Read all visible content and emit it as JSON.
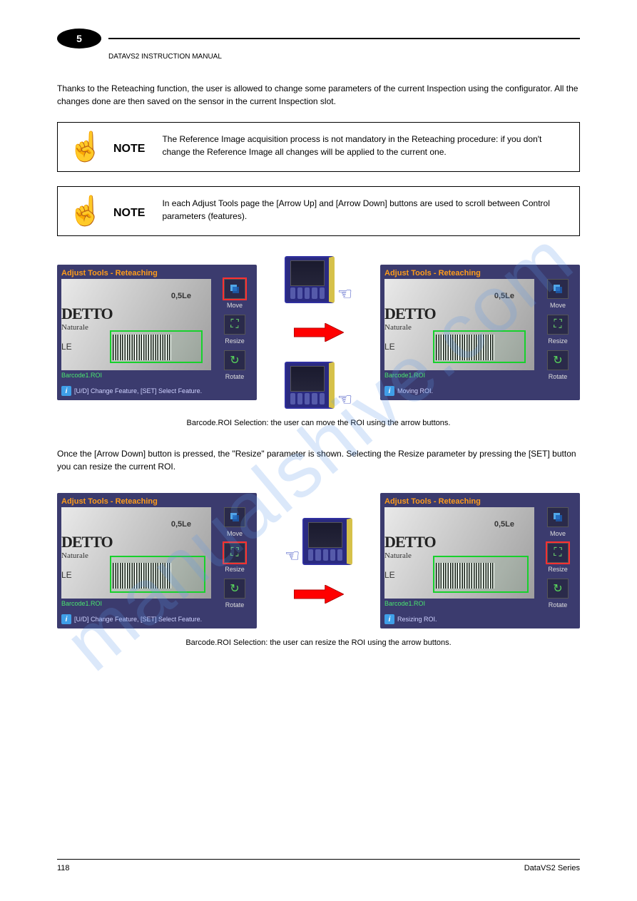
{
  "watermark": "manualshive.com",
  "header": {
    "chapter_num": "5",
    "chapter_title": "DATAVS2 INSTRUCTION MANUAL"
  },
  "intro": "Thanks to the Reteaching function, the user is allowed to change some parameters of the current Inspection using the configurator. All the changes done are then saved on the sensor in the current Inspection slot.",
  "note1": {
    "label": "NOTE",
    "text": "The Reference Image acquisition process is not mandatory in the Reteaching procedure: if you don't change the Reference Image all changes will be applied to the current one."
  },
  "note2": {
    "label": "NOTE",
    "text": "In each Adjust Tools page the [Arrow Up] and [Arrow Down] buttons are used to scroll between Control parameters (features)."
  },
  "shot_common": {
    "title": "Adjust Tools - Reteaching",
    "detto": "DETTO",
    "subscript": "Naturale",
    "le": "LE",
    "bottle": "0,5Le",
    "roi_label": "Barcode1.ROI",
    "tool_move": "Move",
    "tool_resize": "Resize",
    "tool_rotate": "Rotate"
  },
  "shot1a_status": "[U/D] Change Feature, [SET] Select Feature.",
  "shot1b_status": "Moving ROI.",
  "caption1": "Barcode.ROI Selection: the user can move the ROI using the arrow buttons.",
  "middle": "Once the [Arrow Down] button is pressed, the \"Resize\" parameter is shown. Selecting the Resize parameter by pressing the [SET] button you can resize the current ROI.",
  "shot2a_status": "[U/D] Change Feature, [SET] Select Feature.",
  "shot2b_status": "Resizing ROI.",
  "caption2": "Barcode.ROI Selection: the user can resize the ROI using the arrow buttons.",
  "footer": {
    "page": "118",
    "brand": "DataVS2 Series"
  }
}
